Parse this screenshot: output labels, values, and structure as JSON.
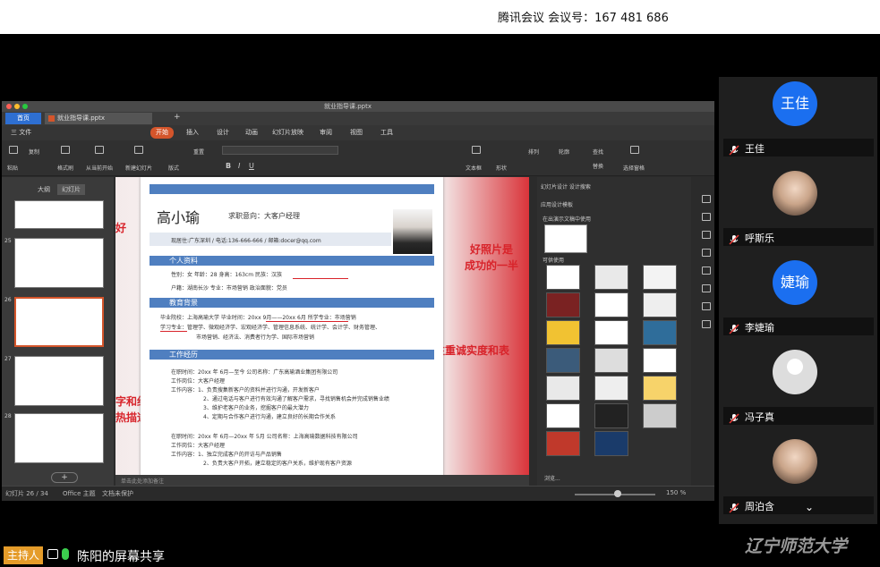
{
  "meeting": {
    "title": "腾讯会议 会议号：167 481 686"
  },
  "window": {
    "title": "就业指导课.pptx"
  },
  "tabs": {
    "home": "首页",
    "file": "就业指导课.pptx",
    "add": "+"
  },
  "menu": [
    "三 文件",
    "开始",
    "插入",
    "设计",
    "动画",
    "幻灯片放映",
    "审阅",
    "视图",
    "工具"
  ],
  "ribbon": [
    "粘贴",
    "复制",
    "格式刷",
    "从当前开始",
    "新建幻灯片",
    "重置",
    "版式",
    "文本框",
    "形状",
    "排列",
    "轮廓",
    "查找",
    "替换",
    "选择窗格"
  ],
  "sidepanel": {
    "tab_outline": "大纲",
    "tab_slides": "幻灯片",
    "slide_numbers": [
      "25",
      "26",
      "27",
      "28"
    ],
    "add": "+"
  },
  "slide": {
    "name": "高小瑜",
    "objective": "求职意向：大客户经理",
    "contact": "现居住:广东深圳    /    电话:136-666-666    /    邮箱:docer@qq.com",
    "sec_personal": "个人资料",
    "personal_line1": "性别：女              年龄：28              身高：163cm              民族：汉族",
    "personal_line2": "户籍：湖南长沙      专业：市场营销      政治面貌：党员",
    "sec_edu": "教育背景",
    "edu_line1": "毕业院校：上海高瑜大学    毕业时间：20xx 9月——20xx 6月    所学专业：市场营销",
    "edu_line2": "学习专业：管理学、微观经济学、宏观经济学、管理信息系统、统计学、会计学、财务管理、",
    "edu_line3": "市场营销、经济法、消费者行为学、国际市场营销",
    "sec_work": "工作经历",
    "work1_1": "在职时间：20xx 年 6月—至今      公司名称：广东高瑜酒业集团有限公司",
    "work1_2": "工作岗位：大客户经理",
    "work1_3": "工作内容：1、负责搜集新客户的资料并进行沟通，开发新客户",
    "work1_4": "2、通过电话与客户进行有效沟通了解客户需求，寻找销售机会并完成销售业绩",
    "work1_5": "3、维护老客户的业务，挖掘客户的最大潜力",
    "work1_6": "4、定期与合作客户进行沟通，建立良好的长期合作关系",
    "work2_1": "在职时间：20xx 年 6月—20xx 年 5月      公司名称：上海高瑜数据科技有限公司",
    "work2_2": "工作岗位：大客户经理",
    "work2_3": "工作内容：1、独立完成客户的开访与产品销售",
    "work2_4": "2、负责大客户开拓，建立稳定的客户关系，维护现有客户资源",
    "notes": "单击此处添加备注"
  },
  "annotations": {
    "left_top": "好",
    "right_top1": "好照片是",
    "right_top2": "成功的一半",
    "right_mid": "注重诚实度和表",
    "left_bot1": "字和细节",
    "left_bot2": "热描述"
  },
  "rightpanel": {
    "header": "幻灯片设计    设计搜索",
    "sub1": "应用设计模板",
    "sub2": "在出演示文稿中使用",
    "sub3": "可供使用",
    "more": "浏览..."
  },
  "status": {
    "slide": "幻灯片 26 / 34",
    "theme": "Office 主题",
    "protect": "文档未保护",
    "zoom": "150 %"
  },
  "participants": [
    {
      "name": "王佳",
      "avatar_text": "王佳",
      "type": "text"
    },
    {
      "name": "呼斯乐",
      "avatar_text": "",
      "type": "photo"
    },
    {
      "name": "李婕瑜",
      "avatar_text": "婕瑜",
      "type": "text"
    },
    {
      "name": "冯子真",
      "avatar_text": "",
      "type": "default"
    },
    {
      "name": "周泊含",
      "avatar_text": "",
      "type": "photo"
    }
  ],
  "bottom": {
    "host": "主持人",
    "share": "陈阳的屏幕共享"
  },
  "watermark": "辽宁师范大学",
  "colors": {
    "accent_blue": "#2e6fd1",
    "avatar_blue": "#1b6ff0",
    "ppt_orange": "#d4552b",
    "resume_blue": "#4f7fc0",
    "anno_red": "#d8232a",
    "host_orange": "#e59c2a"
  }
}
